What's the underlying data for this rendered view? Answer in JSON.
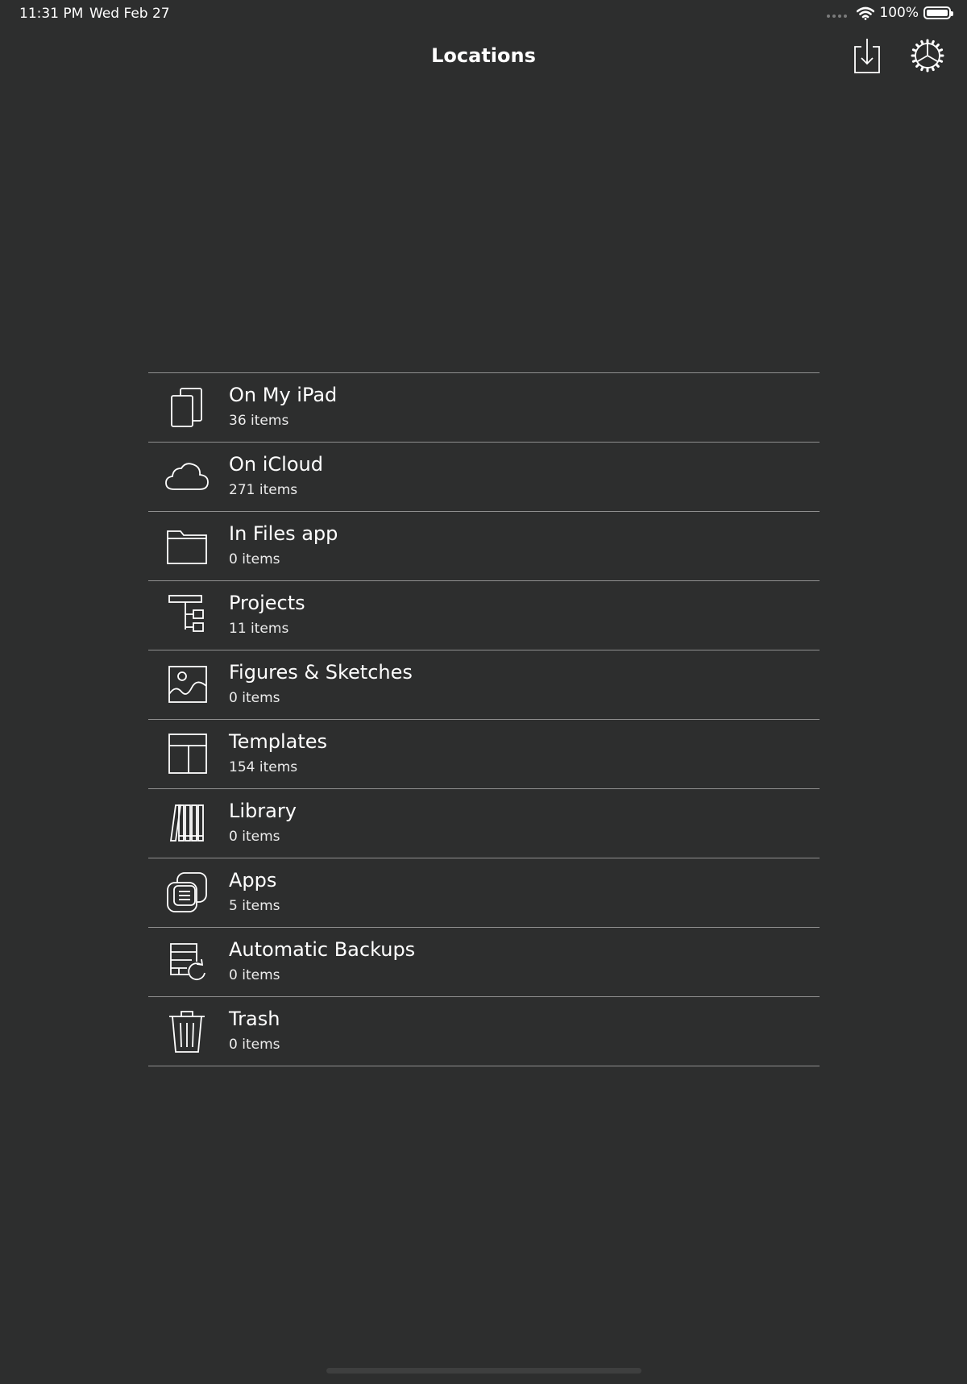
{
  "status_bar": {
    "time": "11:31 PM",
    "date": "Wed Feb 27",
    "battery": "100%",
    "wifi_icon": "wifi-icon",
    "battery_icon": "battery-icon",
    "battery_level": 1.0
  },
  "nav": {
    "title": "Locations",
    "import_icon": "import-icon",
    "settings_icon": "gear-icon"
  },
  "locations": [
    {
      "name": "On My iPad",
      "count": "36 items",
      "icon": "ipad-documents-icon"
    },
    {
      "name": "On iCloud",
      "count": "271 items",
      "icon": "cloud-icon"
    },
    {
      "name": "In Files app",
      "count": "0 items",
      "icon": "folder-icon"
    },
    {
      "name": "Projects",
      "count": "11 items",
      "icon": "projects-icon"
    },
    {
      "name": "Figures & Sketches",
      "count": "0 items",
      "icon": "image-icon"
    },
    {
      "name": "Templates",
      "count": "154 items",
      "icon": "template-icon"
    },
    {
      "name": "Library",
      "count": "0 items",
      "icon": "library-icon"
    },
    {
      "name": "Apps",
      "count": "5 items",
      "icon": "apps-icon"
    },
    {
      "name": "Automatic Backups",
      "count": "0 items",
      "icon": "backup-icon"
    },
    {
      "name": "Trash",
      "count": "0 items",
      "icon": "trash-icon"
    }
  ]
}
